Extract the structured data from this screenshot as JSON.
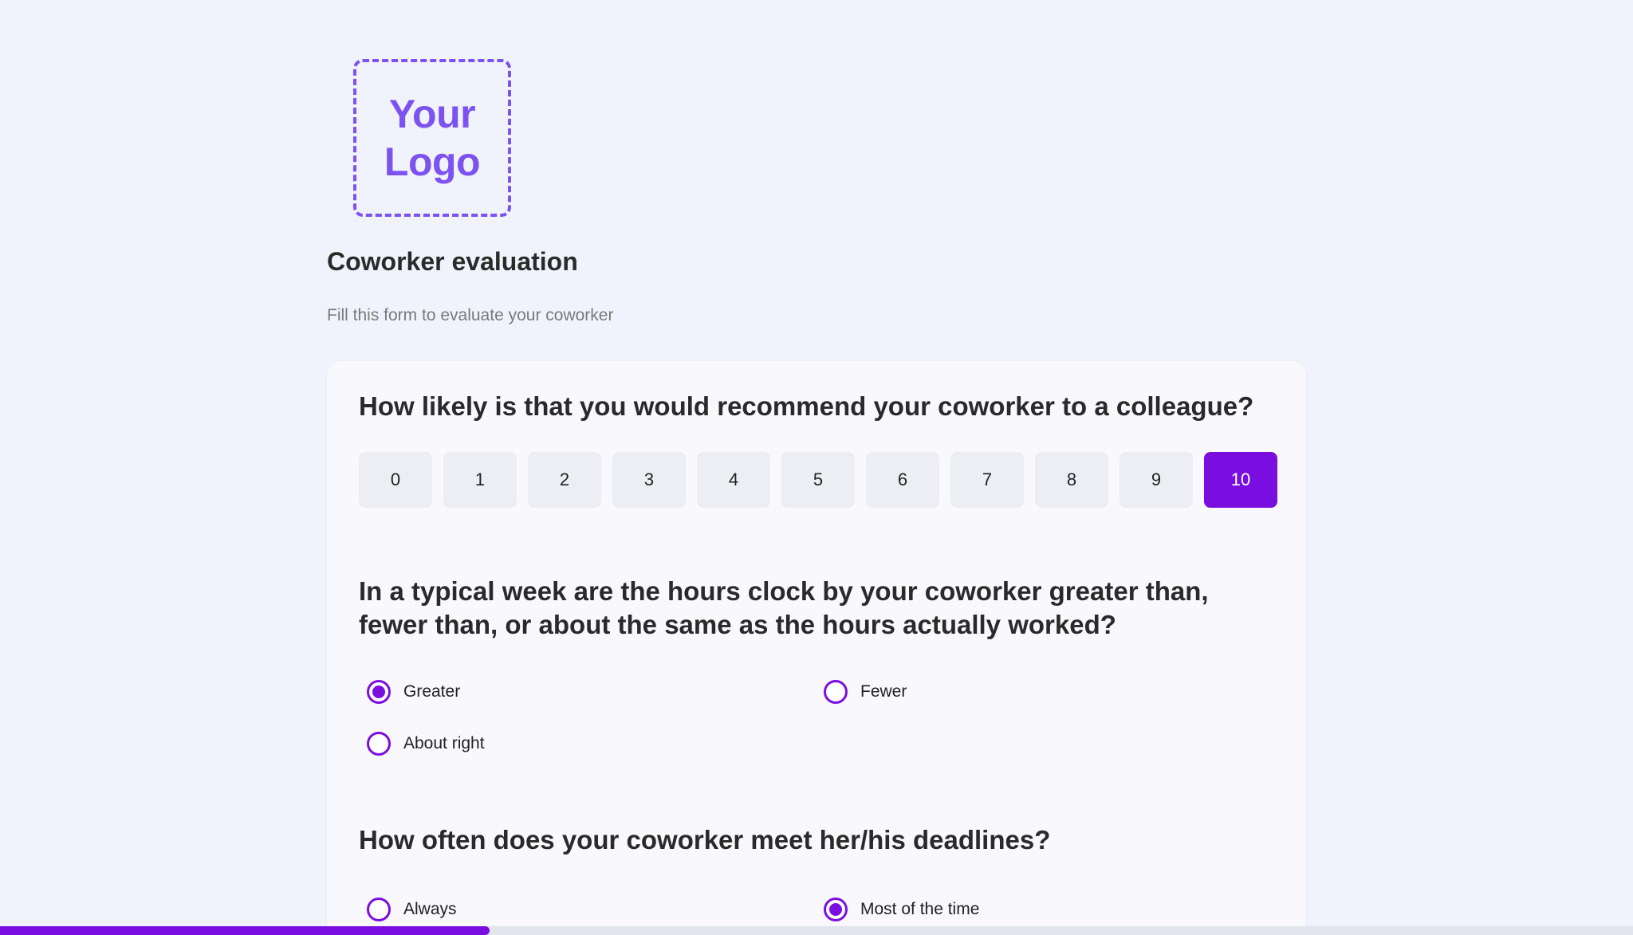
{
  "logo": {
    "line1": "Your",
    "line2": "Logo"
  },
  "form": {
    "title": "Coworker evaluation",
    "subtitle": "Fill this form to evaluate your coworker"
  },
  "questions": {
    "q1": {
      "text": "How likely is that you would recommend your coworker to a colleague?",
      "options": [
        "0",
        "1",
        "2",
        "3",
        "4",
        "5",
        "6",
        "7",
        "8",
        "9",
        "10"
      ],
      "selected": "10"
    },
    "q2": {
      "text": "In a typical week are the hours clock by your coworker greater than, fewer than, or about the same as the hours actually worked?",
      "options": [
        "Greater",
        "Fewer",
        "About right"
      ],
      "selected": "Greater"
    },
    "q3": {
      "text": "How often does your coworker meet her/his deadlines?",
      "options": [
        "Always",
        "Most of the time"
      ],
      "selected": "Most of the time"
    }
  },
  "progress": {
    "fraction": 0.3
  },
  "colors": {
    "accent": "#7a0ee0",
    "logo": "#7c52f0",
    "background": "#f0f3fb"
  }
}
